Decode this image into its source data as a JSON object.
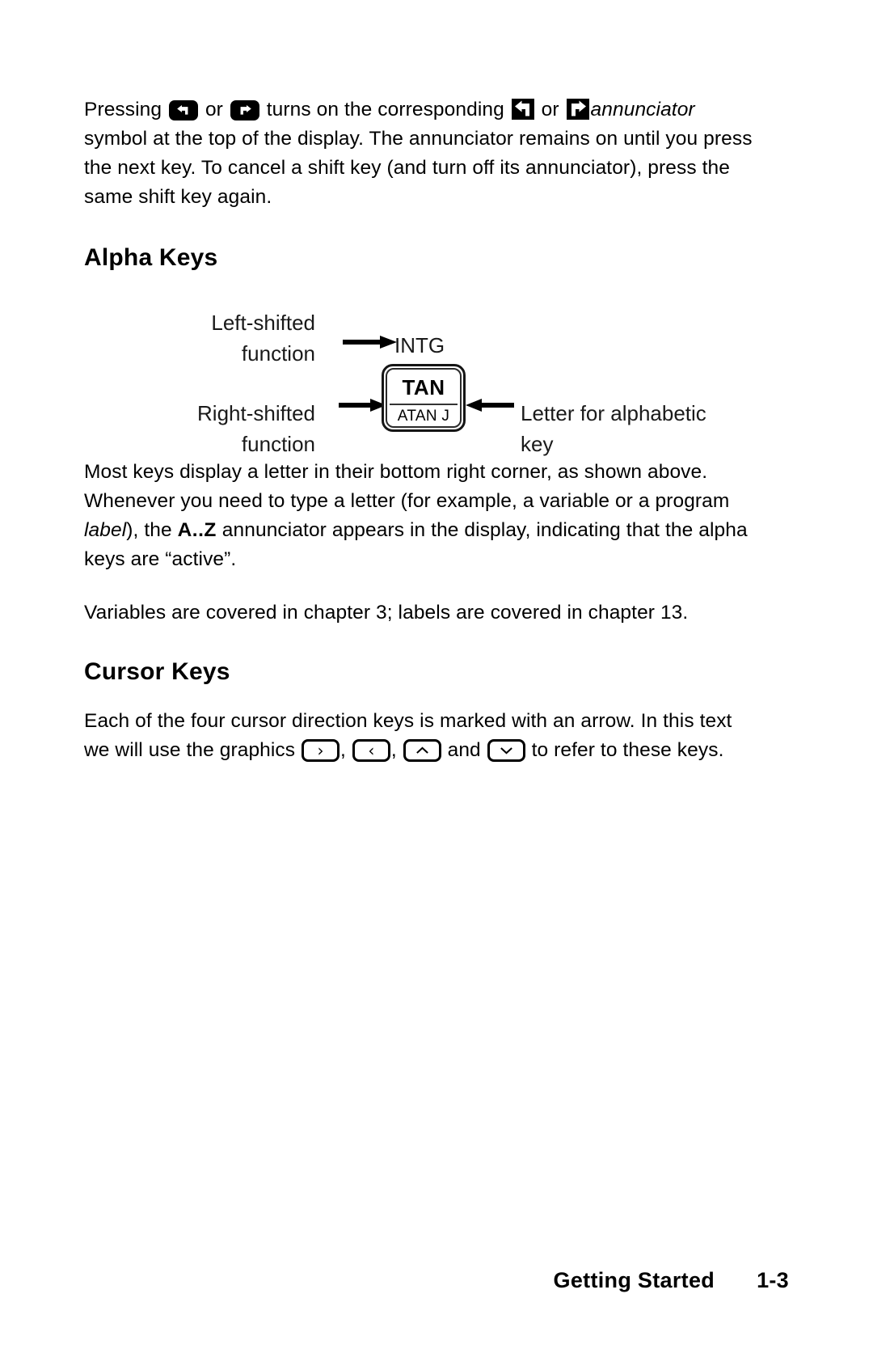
{
  "document": {
    "type": "manual-page",
    "background": "#ffffff",
    "text_color": "#000000"
  },
  "intro_paragraph": {
    "seg1": "Pressing ",
    "seg2": " or ",
    "seg3": " turns on the corresponding ",
    "seg4": " or ",
    "annunciator_word": "annunciator",
    "seg5": " symbol at the top of the display. The annunciator remains on until you press the next key. To cancel a shift key (and turn off its annunciator), press the same shift key again."
  },
  "icons": {
    "left_shift_key": "left-shift-key-icon",
    "right_shift_key": "right-shift-key-icon",
    "left_shift_annunciator": "left-shift-annunciator-icon",
    "right_shift_annunciator": "right-shift-annunciator-icon"
  },
  "sections": {
    "alpha_keys": {
      "heading": "Alpha Keys",
      "figure": {
        "label_left_shifted": "Left-shifted\nfunction",
        "label_left_shifted_line1": "Left-shifted",
        "label_left_shifted_line2": "function",
        "label_right_shifted_line1": "Right-shifted",
        "label_right_shifted_line2": "function",
        "label_letter_line1": "Letter for alphabetic",
        "label_letter_line2": "key",
        "key_top_legend": "INTG",
        "key_primary": "TAN",
        "key_secondary": "ATAN J"
      },
      "paragraph1_a": "Most keys display a letter in their bottom right corner, as shown above. Whenever you need to type a letter (for example, a variable or a program ",
      "paragraph1_italic": "label",
      "paragraph1_b": "), the ",
      "paragraph1_bold": "A..Z",
      "paragraph1_c": " annunciator appears in the display, indicating that the alpha keys are “active”.",
      "paragraph2": "Variables are covered in chapter 3; labels are covered in chapter 13."
    },
    "cursor_keys": {
      "heading": "Cursor Keys",
      "paragraph_a": "Each of the four cursor direction keys is marked with an arrow. In this text we will use the graphics ",
      "sep1": ", ",
      "sep2": ", ",
      "sep3": " and ",
      "paragraph_b": " to refer to these keys.",
      "key_right": "cursor-right-key-icon",
      "key_left": "cursor-left-key-icon",
      "key_up": "cursor-up-key-icon",
      "key_down": "cursor-down-key-icon"
    }
  },
  "footer": {
    "title": "Getting Started",
    "page_number": "1-3"
  }
}
